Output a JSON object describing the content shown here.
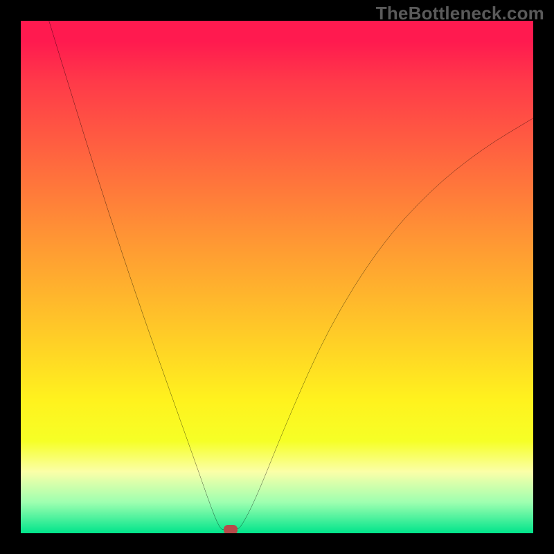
{
  "watermark": {
    "text": "TheBottleneck.com"
  },
  "chart_data": {
    "type": "line",
    "title": "",
    "xlabel": "",
    "ylabel": "",
    "xlim": [
      0,
      100
    ],
    "ylim": [
      0,
      100
    ],
    "grid": false,
    "legend": false,
    "background": {
      "gradient_stops": [
        {
          "pos": 0,
          "color": "#ff1a4f"
        },
        {
          "pos": 4,
          "color": "#ff1a4f"
        },
        {
          "pos": 12,
          "color": "#ff3a49"
        },
        {
          "pos": 28,
          "color": "#ff6a3e"
        },
        {
          "pos": 44,
          "color": "#ff9a33"
        },
        {
          "pos": 60,
          "color": "#ffc828"
        },
        {
          "pos": 74,
          "color": "#fff21e"
        },
        {
          "pos": 82,
          "color": "#f6ff26"
        },
        {
          "pos": 88,
          "color": "#fbffa8"
        },
        {
          "pos": 94,
          "color": "#9dffb0"
        },
        {
          "pos": 100,
          "color": "#00e48b"
        }
      ]
    },
    "series": [
      {
        "name": "bottleneck-curve",
        "color": "#000000",
        "stroke_width": 2.5,
        "points": [
          {
            "x": 5.5,
            "y": 100
          },
          {
            "x": 11,
            "y": 82
          },
          {
            "x": 17,
            "y": 63
          },
          {
            "x": 23,
            "y": 45
          },
          {
            "x": 29,
            "y": 28
          },
          {
            "x": 34,
            "y": 14
          },
          {
            "x": 37.5,
            "y": 4
          },
          {
            "x": 39,
            "y": 0.7
          },
          {
            "x": 40,
            "y": 0.7
          },
          {
            "x": 42,
            "y": 0.7
          },
          {
            "x": 43,
            "y": 1.2
          },
          {
            "x": 46,
            "y": 7
          },
          {
            "x": 52,
            "y": 22
          },
          {
            "x": 60,
            "y": 40
          },
          {
            "x": 70,
            "y": 56
          },
          {
            "x": 80,
            "y": 67
          },
          {
            "x": 90,
            "y": 75
          },
          {
            "x": 100,
            "y": 81
          }
        ]
      }
    ],
    "annotations": [
      {
        "name": "optimal-marker",
        "x": 41,
        "y": 0.7,
        "shape": "rounded-rect",
        "color": "#b74a4a"
      }
    ]
  }
}
